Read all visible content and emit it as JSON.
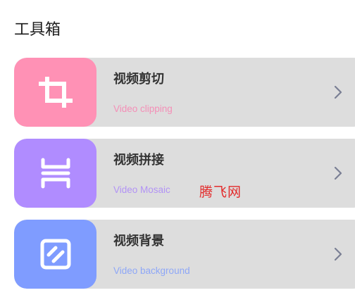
{
  "page": {
    "title": "工具箱"
  },
  "tools": [
    {
      "title": "视频剪切",
      "subtitle": "Video clipping",
      "icon": "crop-icon",
      "tile_color": "#ff91b5",
      "subtitle_color": "#f48fb7"
    },
    {
      "title": "视频拼接",
      "subtitle": "Video Mosaic",
      "icon": "mosaic-icon",
      "tile_color": "#b08cff",
      "subtitle_color": "#b293f5"
    },
    {
      "title": "视频背景",
      "subtitle": "Video background",
      "icon": "background-icon",
      "tile_color": "#7f9cff",
      "subtitle_color": "#8ea7f7"
    }
  ],
  "watermark": "腾飞网",
  "colors": {
    "card_background": "#dddddd",
    "chevron": "#7a7f94",
    "watermark": "#e32b2b"
  }
}
